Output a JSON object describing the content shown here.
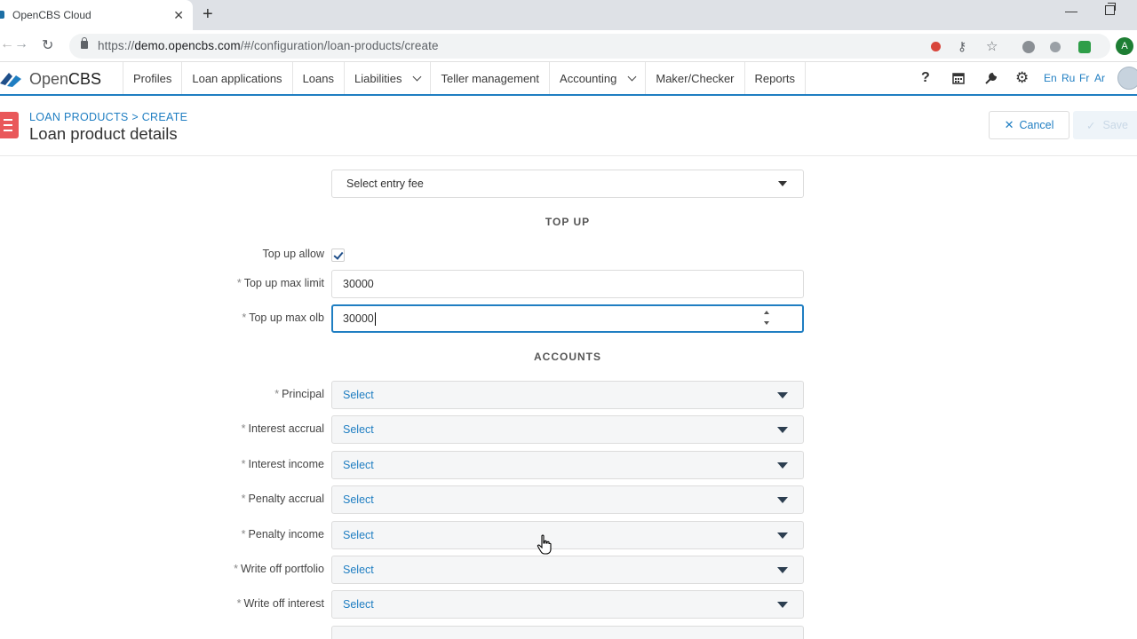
{
  "browser": {
    "tab_title": "OpenCBS Cloud",
    "url_scheme": "https://",
    "url_host": "demo.opencbs.com",
    "url_path": "/#/configuration/loan-products/create",
    "profile_initial": "A"
  },
  "app": {
    "logo_prefix": "Open",
    "logo_suffix": "CBS",
    "menu": [
      "Profiles",
      "Loan applications",
      "Loans",
      "Liabilities",
      "Teller management",
      "Accounting",
      "Maker/Checker",
      "Reports"
    ],
    "languages": [
      "En",
      "Ru",
      "Fr",
      "Ar"
    ],
    "help_glyph": "?",
    "colors": {
      "accent": "#1f7ec2",
      "badge": "#e9585a"
    }
  },
  "page": {
    "breadcrumb": "LOAN PRODUCTS > CREATE",
    "title": "Loan product details",
    "cancel_label": "Cancel",
    "save_label": "Save"
  },
  "form": {
    "entry_fee_placeholder": "Select entry fee",
    "top_up_section": "TOP UP",
    "top_up_allow_label": "Top up allow",
    "top_up_allow_checked": true,
    "top_up_max_limit_label": "Top up max limit",
    "top_up_max_limit_value": "30000",
    "top_up_max_olb_label": "Top up max olb",
    "top_up_max_olb_value": "30000",
    "accounts_section": "ACCOUNTS",
    "accounts": [
      {
        "label": "Principal",
        "value": "Select"
      },
      {
        "label": "Interest accrual",
        "value": "Select"
      },
      {
        "label": "Interest income",
        "value": "Select"
      },
      {
        "label": "Penalty accrual",
        "value": "Select"
      },
      {
        "label": "Penalty income",
        "value": "Select"
      },
      {
        "label": "Write off portfolio",
        "value": "Select"
      },
      {
        "label": "Write off interest",
        "value": "Select"
      }
    ]
  }
}
